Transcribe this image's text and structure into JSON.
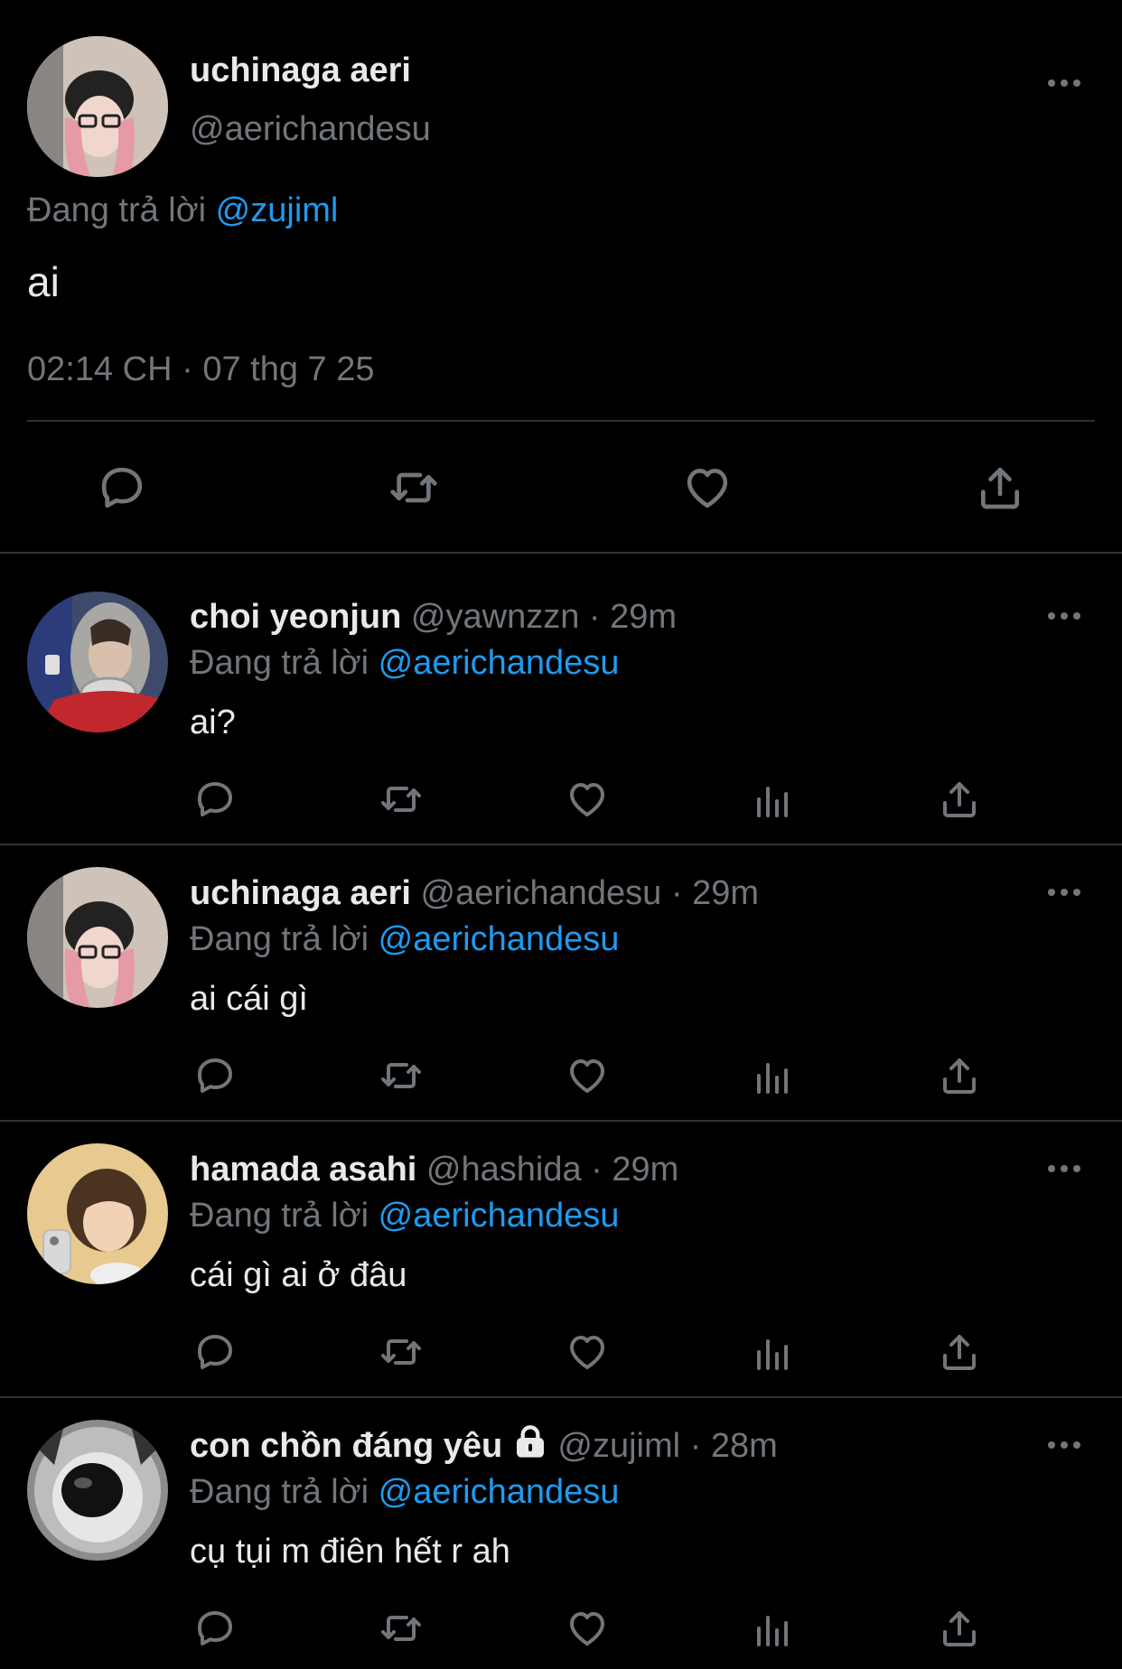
{
  "main_tweet": {
    "display_name": "uchinaga aeri",
    "handle": "@aerichandesu",
    "replying_prefix": "Đang trả lời",
    "replying_to": "@zujiml",
    "text": "ai",
    "time": "02:14 CH",
    "separator": "·",
    "date": "07 thg 7 25"
  },
  "replies": [
    {
      "display_name": "choi yeonjun",
      "handle": "@yawnzzn",
      "time": "29m",
      "replying_prefix": "Đang trả lời",
      "replying_to": "@aerichandesu",
      "text": "ai?"
    },
    {
      "display_name": "uchinaga aeri",
      "handle": "@aerichandesu",
      "time": "29m",
      "replying_prefix": "Đang trả lời",
      "replying_to": "@aerichandesu",
      "text": "ai cái gì"
    },
    {
      "display_name": "hamada asahi",
      "handle": "@hashida",
      "time": "29m",
      "replying_prefix": "Đang trả lời",
      "replying_to": "@aerichandesu",
      "text": "cái gì ai ở đâu"
    },
    {
      "display_name": "con chồn đáng yêu",
      "handle": "@zujiml",
      "time": "28m",
      "replying_prefix": "Đang trả lời",
      "replying_to": "@aerichandesu",
      "text": "cụ tụi m điên hết r ah",
      "protected": true
    }
  ],
  "colors": {
    "background": "#000000",
    "text": "#e7e9ea",
    "muted": "#71767b",
    "accent": "#1d9bf0",
    "divider": "#2f3336"
  },
  "icons": [
    "reply-icon",
    "retweet-icon",
    "like-icon",
    "views-icon",
    "share-icon",
    "more-icon",
    "lock-icon"
  ]
}
